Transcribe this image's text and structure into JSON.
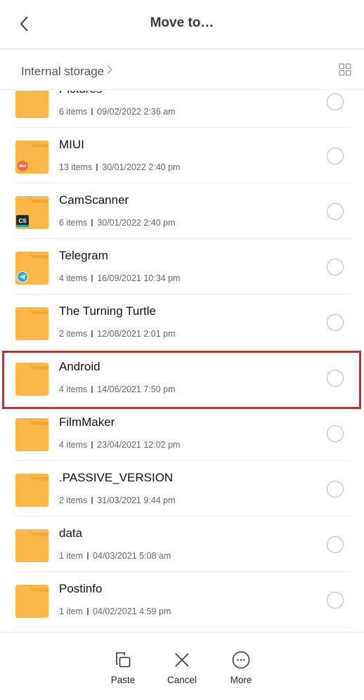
{
  "header": {
    "title": "Move to…",
    "back_icon": "chevron-left-icon"
  },
  "breadcrumb": {
    "location": "Internal storage",
    "separator_icon": "chevron-right-icon",
    "view_toggle_icon": "grid-view-icon"
  },
  "folders": [
    {
      "name": "Pictures",
      "items": "6 items",
      "date": "09/02/2022 2:36 am",
      "badge": null,
      "selected": false
    },
    {
      "name": "MIUI",
      "items": "13 items",
      "date": "30/01/2022 2:40 pm",
      "badge": "miui-app-icon",
      "selected": false
    },
    {
      "name": "CamScanner",
      "items": "6 items",
      "date": "30/01/2022 2:40 pm",
      "badge": "camscanner-app-icon",
      "selected": false
    },
    {
      "name": "Telegram",
      "items": "4 items",
      "date": "16/09/2021 10:34 pm",
      "badge": "telegram-app-icon",
      "selected": false
    },
    {
      "name": "The Turning Turtle",
      "items": "2 items",
      "date": "12/08/2021 2:01 pm",
      "badge": null,
      "selected": false
    },
    {
      "name": "Android",
      "items": "4 items",
      "date": "14/06/2021 7:50 pm",
      "badge": null,
      "selected": false,
      "highlighted": true
    },
    {
      "name": "FilmMaker",
      "items": "4 items",
      "date": "23/04/2021 12:02 pm",
      "badge": null,
      "selected": false
    },
    {
      "name": ".PASSIVE_VERSION",
      "items": "2 items",
      "date": "31/03/2021 9:44 pm",
      "badge": null,
      "selected": false
    },
    {
      "name": "data",
      "items": "1 item",
      "date": "04/03/2021 5:08 am",
      "badge": null,
      "selected": false
    },
    {
      "name": "Postinfo",
      "items": "1 item",
      "date": "04/02/2021 4:59 pm",
      "badge": null,
      "selected": false
    }
  ],
  "badges": {
    "miui_text": "MIUI",
    "camscanner_text": "CS"
  },
  "colors": {
    "folder": "#fbb848",
    "folder_tab": "#f0a532",
    "highlight_border": "#e0202b",
    "miui_badge": "#f0684b",
    "camscanner_badge": "#1d2a2e",
    "camscanner_stripe": "#2ba08c",
    "telegram_badge": "#35a3dc"
  },
  "actions": [
    {
      "label": "Paste",
      "icon": "paste-icon"
    },
    {
      "label": "Cancel",
      "icon": "close-icon"
    },
    {
      "label": "More",
      "icon": "more-icon"
    }
  ]
}
